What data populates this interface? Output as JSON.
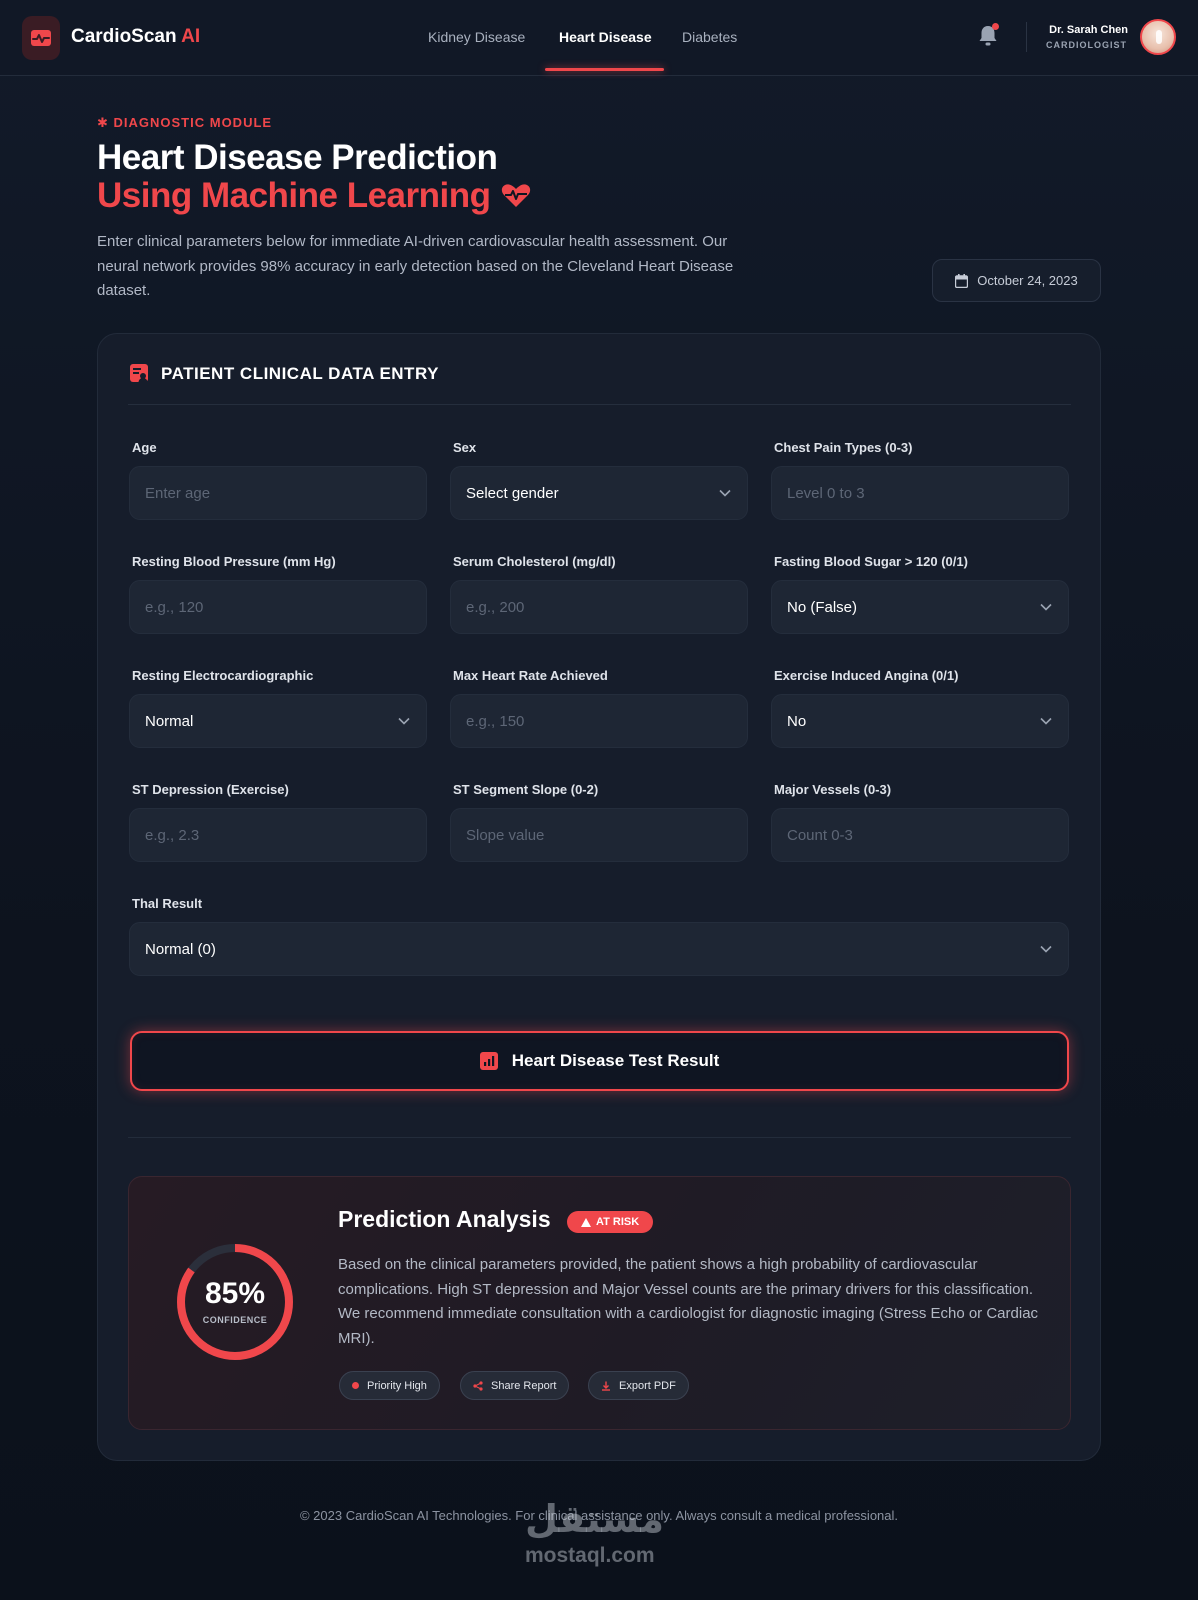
{
  "header": {
    "brand_main": "CardioScan",
    "brand_accent": " AI",
    "tabs": [
      {
        "label": "Kidney Disease"
      },
      {
        "label": "Heart Disease"
      },
      {
        "label": "Diabetes"
      }
    ],
    "active_tab": "Heart Disease",
    "user": {
      "name": "Dr. Sarah Chen",
      "role": "CARDIOLOGIST"
    },
    "notification_dot": true
  },
  "hero": {
    "eyebrow": "DIAGNOSTIC MODULE",
    "title_line1": "Heart Disease Prediction",
    "title_line2": "Using Machine Learning",
    "intro": "Enter clinical parameters below for immediate AI-driven cardiovascular health assessment. Our neural network provides 98% accuracy in early detection based on the Cleveland Heart Disease dataset.",
    "date": "October 24, 2023"
  },
  "form": {
    "section_title": "PATIENT CLINICAL DATA ENTRY",
    "fields": [
      {
        "label": "Age",
        "placeholder": "Enter age"
      },
      {
        "label": "Sex",
        "value": "Select gender"
      },
      {
        "label": "Chest Pain Types (0-3)",
        "placeholder": "Level 0 to 3"
      },
      {
        "label": "Resting Blood Pressure (mm Hg)",
        "placeholder": "e.g., 120"
      },
      {
        "label": "Serum Cholesterol (mg/dl)",
        "placeholder": "e.g., 200"
      },
      {
        "label": "Fasting Blood Sugar > 120 (0/1)",
        "value": "No (False)"
      },
      {
        "label": "Resting Electrocardiographic",
        "value": "Normal"
      },
      {
        "label": "Max Heart Rate Achieved",
        "placeholder": "e.g., 150"
      },
      {
        "label": "Exercise Induced Angina (0/1)",
        "value": "No"
      },
      {
        "label": "ST Depression (Exercise)",
        "placeholder": "e.g., 2.3"
      },
      {
        "label": "ST Segment Slope (0-2)",
        "placeholder": "Slope value"
      },
      {
        "label": "Major Vessels (0-3)",
        "placeholder": "Count 0-3"
      },
      {
        "label": "Thal Result",
        "value": "Normal (0)"
      }
    ],
    "submit_label": "Heart Disease Test Result"
  },
  "analysis": {
    "title": "Prediction Analysis",
    "badge": "AT RISK",
    "confidence_value": "85%",
    "confidence_fraction": 0.85,
    "confidence_label": "CONFIDENCE",
    "text": "Based on the clinical parameters provided, the patient shows a high probability of cardiovascular complications. High ST depression and Major Vessel counts are the primary drivers for this classification. We recommend immediate consultation with a cardiologist for diagnostic imaging (Stress Echo or Cardiac MRI).",
    "actions": [
      {
        "label": "Priority High",
        "icon": "dot-icon"
      },
      {
        "label": "Share Report",
        "icon": "share-icon"
      },
      {
        "label": "Export PDF",
        "icon": "download-icon"
      }
    ]
  },
  "footer": {
    "text": "© 2023 CardioScan AI Technologies. For clinical assistance only. Always consult a medical professional."
  },
  "watermark": {
    "arabic": "مستقل",
    "latin": "mostaql.com"
  },
  "colors": {
    "accent": "#f0474b",
    "background": "#0f1521",
    "card": "#161d2b",
    "input": "#1e2634"
  }
}
